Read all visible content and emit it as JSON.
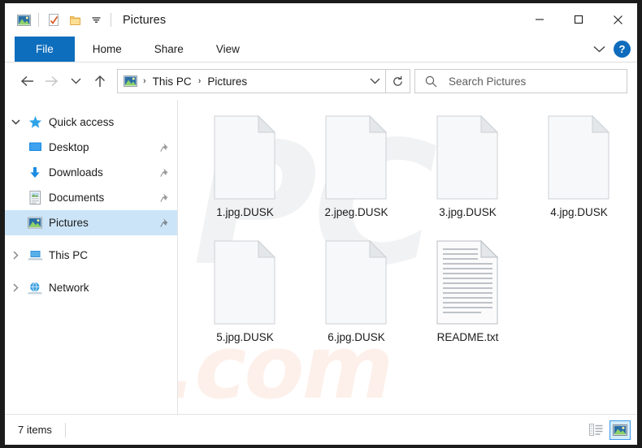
{
  "window": {
    "title": "Pictures",
    "accent_color": "#0d6ebe",
    "selection_color": "#cce4f7",
    "controls": {
      "minimize": "minimize-button",
      "maximize": "maximize-button",
      "close": "close-button"
    }
  },
  "quick_access_toolbar": {
    "items": [
      {
        "icon": "pictures-folder-icon",
        "label": "Pictures"
      },
      {
        "icon": "properties-icon",
        "label": "Properties"
      },
      {
        "icon": "new-folder-icon",
        "label": "New folder"
      },
      {
        "icon": "customize-dropdown-icon",
        "label": "Customize Quick Access Toolbar"
      }
    ]
  },
  "ribbon": {
    "tabs": [
      {
        "label": "File",
        "active": true
      },
      {
        "label": "Home",
        "active": false
      },
      {
        "label": "Share",
        "active": false
      },
      {
        "label": "View",
        "active": false
      }
    ],
    "expand_label": "Expand the Ribbon",
    "help_label": "?"
  },
  "navigation": {
    "back": "Back",
    "forward": "Forward",
    "recent": "Recent locations",
    "up": "Up one level",
    "refresh": "Refresh",
    "breadcrumb": {
      "icon": "pictures-folder-icon",
      "parts": [
        "This PC",
        "Pictures"
      ],
      "separator": "›"
    }
  },
  "search": {
    "placeholder": "Search Pictures",
    "value": "",
    "icon": "search-icon"
  },
  "sidebar": {
    "items": [
      {
        "label": "Quick access",
        "icon": "star-icon",
        "twisty": "expanded",
        "indent": false,
        "pinned": false,
        "selected": false
      },
      {
        "label": "Desktop",
        "icon": "desktop-icon",
        "twisty": "none",
        "indent": true,
        "pinned": true,
        "selected": false
      },
      {
        "label": "Downloads",
        "icon": "downloads-icon",
        "twisty": "none",
        "indent": true,
        "pinned": true,
        "selected": false
      },
      {
        "label": "Documents",
        "icon": "documents-icon",
        "twisty": "none",
        "indent": true,
        "pinned": true,
        "selected": false
      },
      {
        "label": "Pictures",
        "icon": "pictures-icon",
        "twisty": "none",
        "indent": true,
        "pinned": true,
        "selected": true
      },
      {
        "label": "This PC",
        "icon": "this-pc-icon",
        "twisty": "collapsed",
        "indent": false,
        "pinned": false,
        "selected": false
      },
      {
        "label": "Network",
        "icon": "network-icon",
        "twisty": "collapsed",
        "indent": false,
        "pinned": false,
        "selected": false
      }
    ]
  },
  "files": [
    {
      "name": "1.jpg.DUSK",
      "icon": "blank-file-icon"
    },
    {
      "name": "2.jpeg.DUSK",
      "icon": "blank-file-icon"
    },
    {
      "name": "3.jpg.DUSK",
      "icon": "blank-file-icon"
    },
    {
      "name": "4.jpg.DUSK",
      "icon": "blank-file-icon"
    },
    {
      "name": "5.jpg.DUSK",
      "icon": "blank-file-icon"
    },
    {
      "name": "6.jpg.DUSK",
      "icon": "blank-file-icon"
    },
    {
      "name": "README.txt",
      "icon": "text-file-icon"
    }
  ],
  "watermarks": {
    "background_text": "PC",
    "foreground_text": "risk.com"
  },
  "statusbar": {
    "item_count": "7 items",
    "views": [
      {
        "name": "details-view-button",
        "active": false
      },
      {
        "name": "large-icons-view-button",
        "active": true
      }
    ]
  }
}
